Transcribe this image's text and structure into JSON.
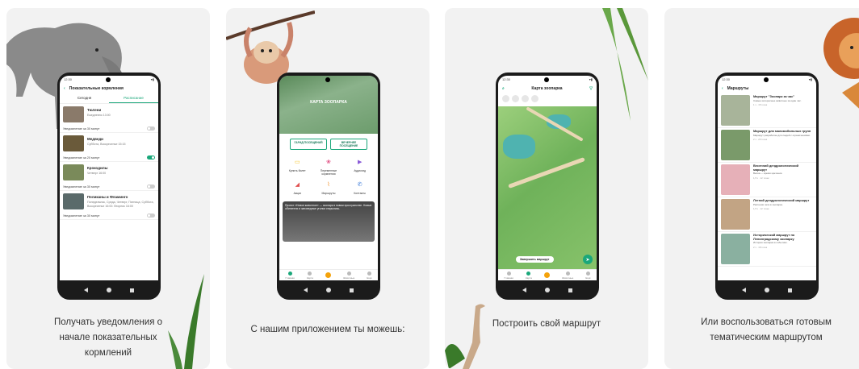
{
  "cards": [
    {
      "caption": "Получать уведомления о начале показательных кормлений"
    },
    {
      "caption": "С нашим приложением ты можешь:"
    },
    {
      "caption": "Построить свой маршрут"
    },
    {
      "caption": "Или воспользоваться готовым тематическим маршрутом"
    }
  ],
  "screen1": {
    "title": "Показательные кормления",
    "tabs": [
      "Сегодня",
      "Расписание"
    ],
    "items": [
      {
        "name": "Тюлени",
        "time": "Ежедневно 13:00",
        "notify": "Уведомление за 30 минут",
        "on": false
      },
      {
        "name": "Медведи",
        "time": "Суббота, Воскресенье 15:15",
        "notify": "Уведомление за 20 минут",
        "on": true
      },
      {
        "name": "Крокодилы",
        "time": "Четверг 16:00",
        "notify": "Уведомление за 30 минут",
        "on": false
      },
      {
        "name": "Пеликаны и Фламинго",
        "time": "Понедельник, Среда, Четверг, Пятница, Суббота, Воскресенье 16:00. Вторник 16:00",
        "notify": "Уведомление за 30 минут",
        "on": false
      }
    ]
  },
  "screen2": {
    "hero_title": "КАРТА ЗООПАРКА",
    "btn_left": "ГАРИД ПОСЕЩЕНИЙ",
    "btn_right": "ВЕЧЕРНЕЕ ПОСЕЩЕНИЕ",
    "menu": [
      {
        "label": "Купить билет",
        "icon": "▭",
        "color": "#f6c21a"
      },
      {
        "label": "Переменные кормления",
        "icon": "❀",
        "color": "#e35a8a"
      },
      {
        "label": "Аудиогид",
        "icon": "▶",
        "color": "#8a5ad8"
      },
      {
        "label": "Акции",
        "icon": "◢",
        "color": "#e05252"
      },
      {
        "label": "Маршруты",
        "icon": "⌇",
        "color": "#f08a1a"
      },
      {
        "label": "Контакты",
        "icon": "✆",
        "color": "#3a7ad8"
      }
    ],
    "news_text": "Проект «Новое животное» — зоопарк в новом пространстве. Новые обитатели и заповедные уголки открылись.",
    "tabs": [
      "Главная",
      "Карта",
      "",
      "Животные",
      "Ещё"
    ]
  },
  "screen3": {
    "title": "Карта зоопарка",
    "route_button": "Завершить маршрут",
    "tabs": [
      "Главная",
      "Карта",
      "",
      "Животные",
      "Ещё"
    ]
  },
  "screen4": {
    "title": "Маршруты",
    "items": [
      {
        "title": "Маршрут \"Зоопарк за час\"",
        "desc": "Самые интересные животные за один час.",
        "meta": "1 ч · 15 точек",
        "color": "#a8b49a"
      },
      {
        "title": "Маршрут для маломобильных групп",
        "desc": "Маршрут разработан для людей с ограничениями.",
        "meta": "2 ч · 20 точек",
        "color": "#7a9a6a"
      },
      {
        "title": "Весенний дендрологический маршрут",
        "desc": "Весна — время цветения.",
        "meta": "1,5 ч · 12 точек",
        "color": "#e6b0b8"
      },
      {
        "title": "Летний дендрологический маршрут",
        "desc": "Растения лета в зоопарке.",
        "meta": "1,5 ч · 12 точек",
        "color": "#c2a484"
      },
      {
        "title": "Исторический маршрут по Ленинградскому зоопарку",
        "desc": "История зоопарка в событиях.",
        "meta": "2 ч · 18 точек",
        "color": "#8ab0a0"
      }
    ]
  }
}
